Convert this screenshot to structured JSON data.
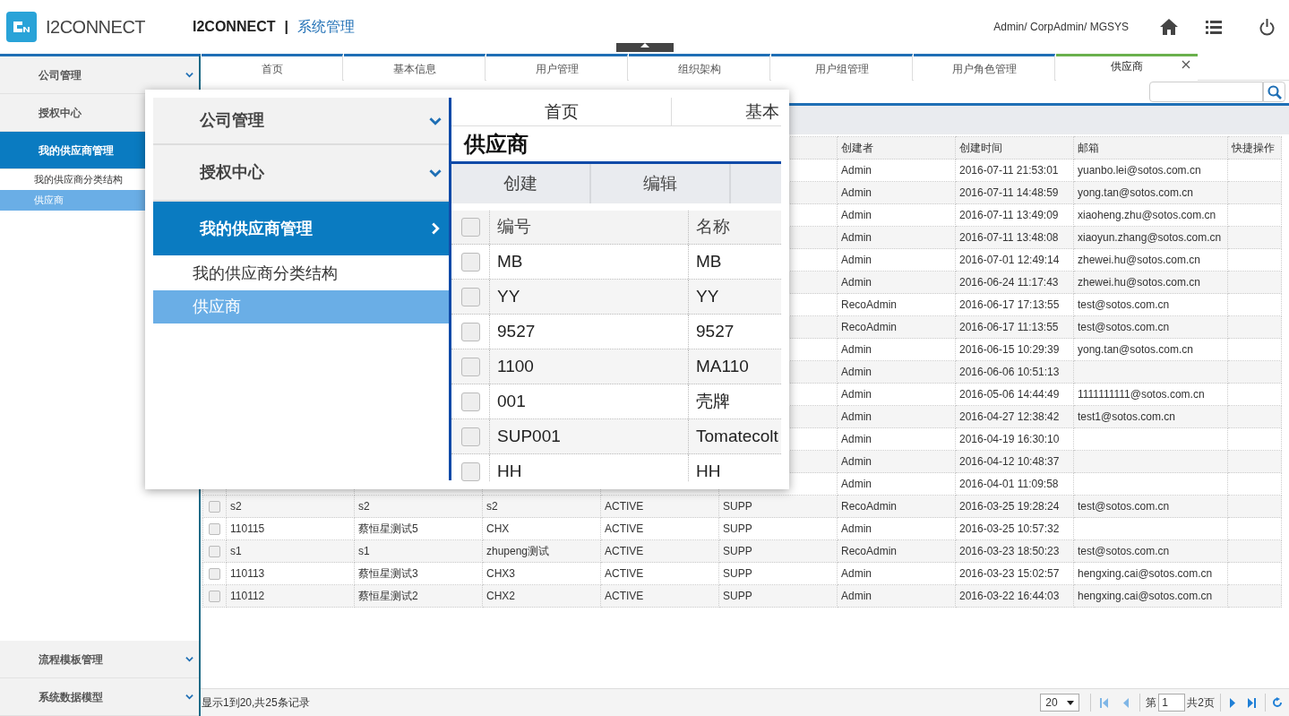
{
  "header": {
    "logo_text": "I2CONNECT",
    "app_name": "I2CONNECT",
    "separator": "|",
    "module": "系统管理",
    "user": "Admin/ CorpAdmin/ MGSYS"
  },
  "sidebar": {
    "items": [
      {
        "label": "公司管理",
        "selected": false
      },
      {
        "label": "授权中心",
        "selected": false
      },
      {
        "label": "我的供应商管理",
        "selected": true,
        "children": [
          {
            "label": "我的供应商分类结构",
            "selected": false
          },
          {
            "label": "供应商",
            "selected": true
          }
        ]
      }
    ],
    "bottom_items": [
      {
        "label": "流程模板管理",
        "selected": false
      },
      {
        "label": "系统数据模型",
        "selected": false
      }
    ]
  },
  "tabs": [
    {
      "label": "首页",
      "selected": false,
      "closable": false
    },
    {
      "label": "基本信息",
      "selected": false,
      "closable": false
    },
    {
      "label": "用户管理",
      "selected": false,
      "closable": false
    },
    {
      "label": "组织架构",
      "selected": false,
      "closable": false
    },
    {
      "label": "用户组管理",
      "selected": false,
      "closable": false
    },
    {
      "label": "用户角色管理",
      "selected": false,
      "closable": false
    },
    {
      "label": "供应商",
      "selected": true,
      "closable": true
    }
  ],
  "table": {
    "visible_headers": [
      "创建者",
      "创建时间",
      "邮箱",
      "快捷操作"
    ],
    "rows": [
      {
        "creator": "Admin",
        "created": "2016-07-11 21:53:01",
        "email": "yuanbo.lei@sotos.com.cn"
      },
      {
        "creator": "Admin",
        "created": "2016-07-11 14:48:59",
        "email": "yong.tan@sotos.com.cn"
      },
      {
        "creator": "Admin",
        "created": "2016-07-11 13:49:09",
        "email": "xiaoheng.zhu@sotos.com.cn"
      },
      {
        "creator": "Admin",
        "created": "2016-07-11 13:48:08",
        "email": "xiaoyun.zhang@sotos.com.cn"
      },
      {
        "creator": "Admin",
        "created": "2016-07-01 12:49:14",
        "email": "zhewei.hu@sotos.com.cn"
      },
      {
        "creator": "Admin",
        "created": "2016-06-24 11:17:43",
        "email": "zhewei.hu@sotos.com.cn"
      },
      {
        "creator": "RecoAdmin",
        "created": "2016-06-17 17:13:55",
        "email": "test@sotos.com.cn"
      },
      {
        "creator": "RecoAdmin",
        "created": "2016-06-17 11:13:55",
        "email": "test@sotos.com.cn"
      },
      {
        "creator": "Admin",
        "created": "2016-06-15 10:29:39",
        "email": "yong.tan@sotos.com.cn"
      },
      {
        "creator": "Admin",
        "created": "2016-06-06 10:51:13"
      },
      {
        "creator": "Admin",
        "created": "2016-05-06 14:44:49",
        "email": "1111111111@sotos.com.cn"
      },
      {
        "creator": "Admin",
        "created": "2016-04-27 12:38:42",
        "email": "test1@sotos.com.cn"
      },
      {
        "creator": "Admin",
        "created": "2016-04-19 16:30:10"
      },
      {
        "creator": "Admin",
        "created": "2016-04-12 10:48:37"
      },
      {
        "creator": "Admin",
        "created": "2016-04-01 11:09:58"
      },
      {
        "checked": false,
        "code": "s2",
        "name": "s2",
        "column_3": "s2",
        "status": "ACTIVE",
        "type": "SUPP",
        "creator": "RecoAdmin",
        "created": "2016-03-25 19:28:24",
        "email": "test@sotos.com.cn"
      },
      {
        "checked": false,
        "code": "110115",
        "name": "蔡恒星测试5",
        "column_3": "CHX",
        "status": "ACTIVE",
        "type": "SUPP",
        "creator": "Admin",
        "created": "2016-03-25 10:57:32"
      },
      {
        "checked": false,
        "code": "s1",
        "name": "s1",
        "column_3": "zhupeng测试",
        "status": "ACTIVE",
        "type": "SUPP",
        "creator": "RecoAdmin",
        "created": "2016-03-23 18:50:23",
        "email": "test@sotos.com.cn"
      },
      {
        "checked": false,
        "code": "110113",
        "name": "蔡恒星测试3",
        "column_3": "CHX3",
        "status": "ACTIVE",
        "type": "SUPP",
        "creator": "Admin",
        "created": "2016-03-23 15:02:57",
        "email": "hengxing.cai@sotos.com.cn"
      },
      {
        "checked": false,
        "code": "110112",
        "name": "蔡恒星测试2",
        "column_3": "CHX2",
        "status": "ACTIVE",
        "type": "SUPP",
        "creator": "Admin",
        "created": "2016-03-22 16:44:03",
        "email": "hengxing.cai@sotos.com.cn"
      }
    ]
  },
  "footer": {
    "summary": "显示1到20,共25条记录",
    "page_size": "20",
    "page_prefix": "第",
    "page": "1",
    "total": "共2页"
  },
  "inset": {
    "sidebar": [
      {
        "label": "公司管理",
        "selected": false
      },
      {
        "label": "授权中心",
        "selected": false
      },
      {
        "label": "我的供应商管理",
        "selected": true,
        "children": [
          {
            "label": "我的供应商分类结构",
            "selected": false
          },
          {
            "label": "供应商",
            "selected": true
          }
        ]
      }
    ],
    "tabs": [
      "首页",
      "基本"
    ],
    "title": "供应商",
    "buttons": [
      "创建",
      "编辑"
    ],
    "columns": [
      "编号",
      "名称"
    ],
    "header_checked": false,
    "rows": [
      {
        "checked": false,
        "code": "MB",
        "name": "MB"
      },
      {
        "checked": false,
        "code": "YY",
        "name": "YY"
      },
      {
        "checked": false,
        "code": "9527",
        "name": "9527"
      },
      {
        "checked": false,
        "code": "1100",
        "name": "MA110"
      },
      {
        "checked": false,
        "code": "001",
        "name": "壳牌"
      },
      {
        "checked": false,
        "code": "SUP001",
        "name": "Tomatecolt"
      },
      {
        "checked": false,
        "code": "HH",
        "name": "HH"
      }
    ]
  }
}
